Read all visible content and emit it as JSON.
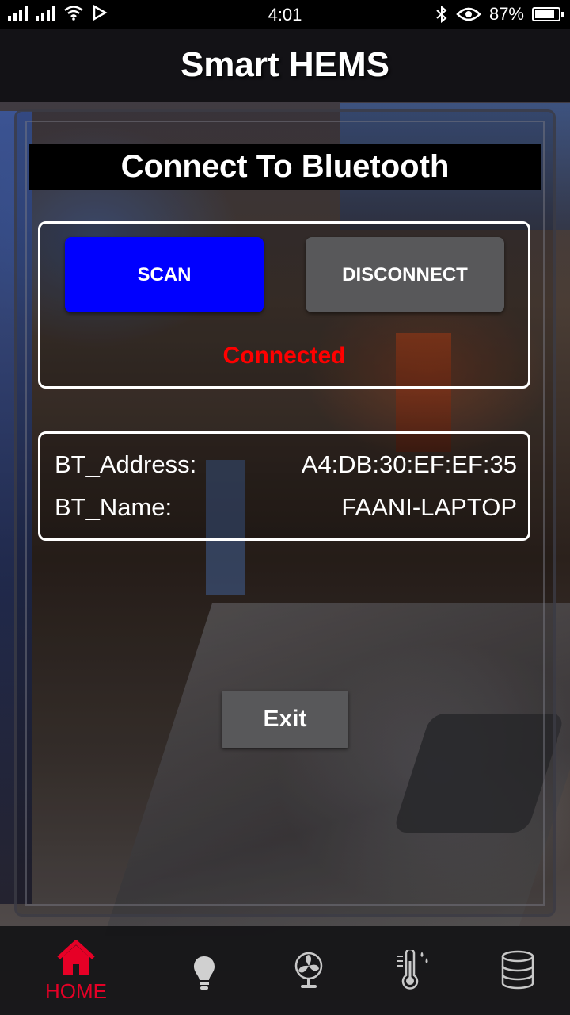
{
  "status_bar": {
    "time": "4:01",
    "battery": "87%",
    "battery_level": 0.87,
    "icons": [
      "signal-icon",
      "signal-icon",
      "wifi-icon",
      "play-store-icon",
      "bluetooth-icon",
      "eye-icon",
      "battery-icon"
    ]
  },
  "app": {
    "title": "Smart HEMS"
  },
  "section": {
    "title": "Connect To Bluetooth"
  },
  "actions": {
    "scan_label": "SCAN",
    "disconnect_label": "DISCONNECT",
    "status": "Connected",
    "exit_label": "Exit"
  },
  "device": {
    "address_label": "BT_Address:",
    "address_value": "A4:DB:30:EF:EF:35",
    "name_label": "BT_Name:",
    "name_value": "FAANI-LAPTOP"
  },
  "bottom_nav": {
    "items": [
      {
        "icon": "home-icon",
        "label": "HOME",
        "active": true
      },
      {
        "icon": "lightbulb-icon",
        "label": "",
        "active": false
      },
      {
        "icon": "fan-icon",
        "label": "",
        "active": false
      },
      {
        "icon": "thermometer-icon",
        "label": "",
        "active": false
      },
      {
        "icon": "database-icon",
        "label": "",
        "active": false
      }
    ]
  },
  "colors": {
    "scan_button": "#0000ff",
    "secondary_button": "#58585a",
    "status_connected": "#ff0000",
    "nav_active": "#e60026",
    "nav_inactive": "#c8c8c8"
  }
}
